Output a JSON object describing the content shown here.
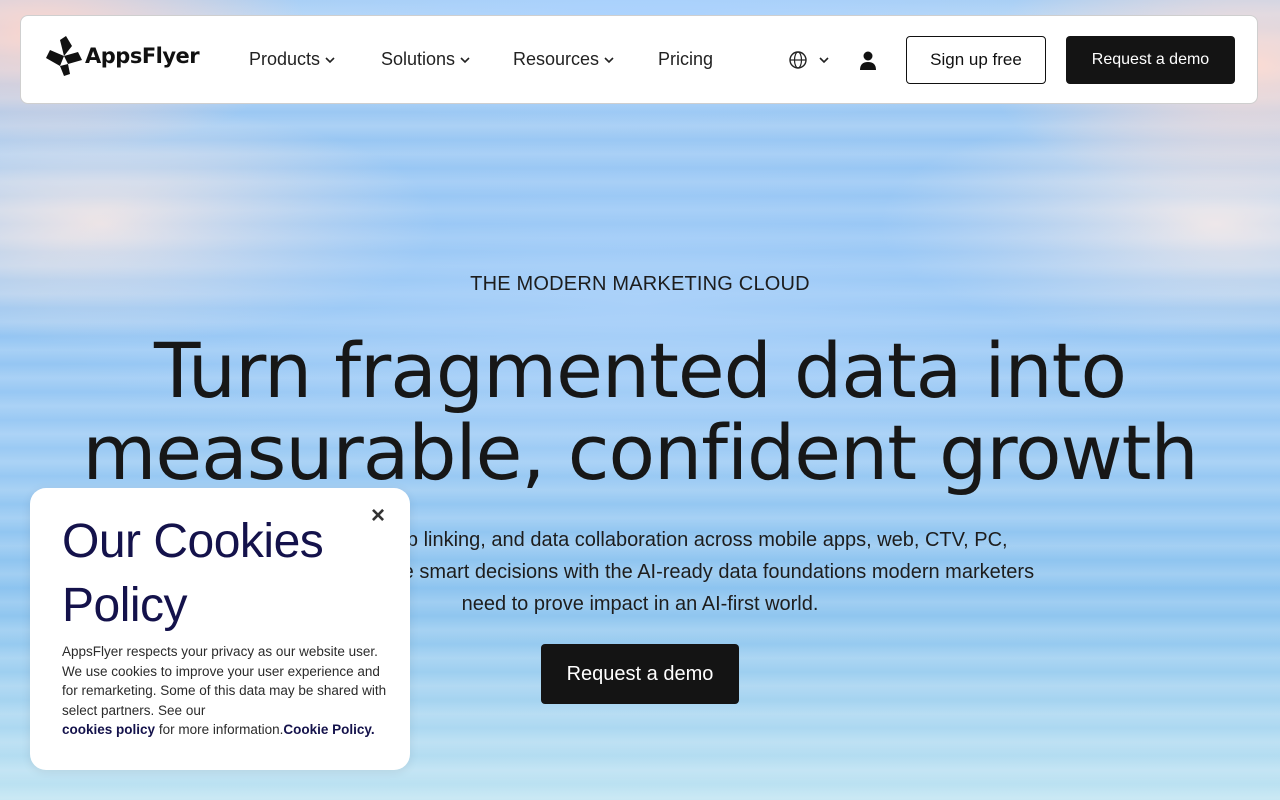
{
  "brand": {
    "name": "AppsFlyer"
  },
  "nav": {
    "items": [
      {
        "label": "Products",
        "has_dropdown": true
      },
      {
        "label": "Solutions",
        "has_dropdown": true
      },
      {
        "label": "Resources",
        "has_dropdown": true
      },
      {
        "label": "Pricing",
        "has_dropdown": false
      }
    ],
    "language_icon": "globe-icon",
    "account_icon": "user-icon",
    "signup_label": "Sign up free",
    "demo_label": "Request a demo"
  },
  "hero": {
    "eyebrow": "THE MODERN MARKETING CLOUD",
    "headline_line1": "Turn fragmented data into",
    "headline_line2": "measurable, confident growth",
    "subtext_line1": "Attribution, deep linking, and data collaboration across mobile apps, web, CTV, PC,",
    "subtext_line2": "and console. Make smart decisions with the AI-ready data foundations modern marketers",
    "subtext_line3": "need to prove impact in an AI-first world.",
    "cta_label": "Request a demo"
  },
  "cookie": {
    "title": "Our Cookies Policy",
    "body": "AppsFlyer respects your privacy as our website user. We use cookies to improve your user experience and for remarketing. Some of this data may be shared with select partners. See our",
    "policy_link": "cookies policy",
    "body_end": "for more information.",
    "cookie_policy_link": "Cookie Policy.",
    "close_icon": "close-icon"
  },
  "colors": {
    "primary_button": "#141414",
    "cookie_title": "#14124b",
    "background": "#9bcaf4"
  }
}
